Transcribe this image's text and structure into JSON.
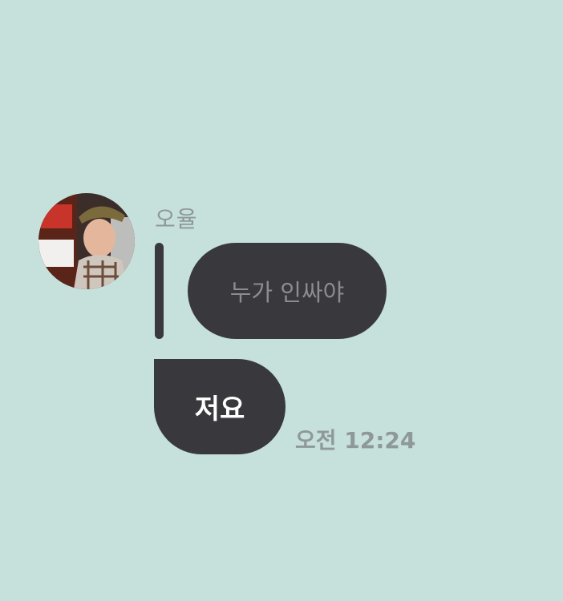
{
  "conversation": {
    "sender": {
      "name": "오율",
      "avatar_icon": "profile-photo"
    },
    "reply": {
      "quoted_text": "누가 인싸야"
    },
    "message": {
      "text": "저요",
      "time": "오전 12:24"
    }
  },
  "colors": {
    "background": "#c6e0dc",
    "bubble": "#39393d",
    "quoted_text": "#8d8d91",
    "meta_text": "#8e9997"
  }
}
